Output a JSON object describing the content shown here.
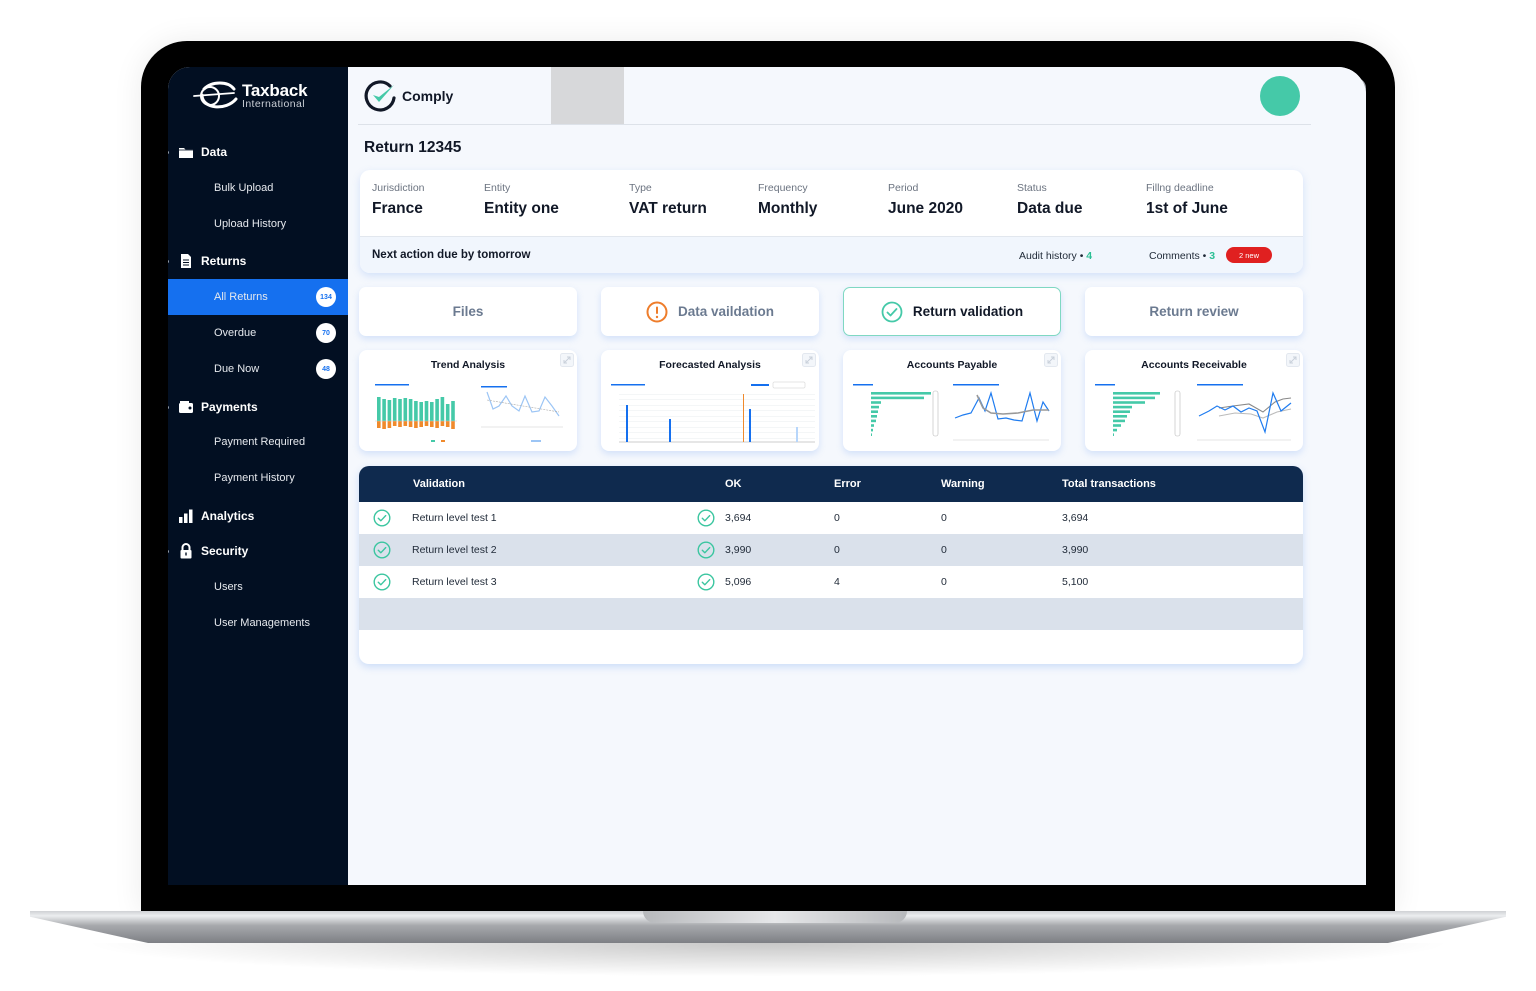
{
  "app": {
    "logo_title": "Taxback",
    "logo_subtitle": "International",
    "brand_name": "Comply"
  },
  "sidebar": {
    "sections": [
      {
        "label": "Data",
        "icon": "folder-icon",
        "items": [
          {
            "label": "Bulk Upload"
          },
          {
            "label": "Upload History"
          }
        ]
      },
      {
        "label": "Returns",
        "icon": "document-icon",
        "items": [
          {
            "label": "All Returns",
            "badge": "134",
            "active": true
          },
          {
            "label": "Overdue",
            "badge": "70"
          },
          {
            "label": "Due Now",
            "badge": "48"
          }
        ]
      },
      {
        "label": "Payments",
        "icon": "wallet-icon",
        "items": [
          {
            "label": "Payment Required"
          },
          {
            "label": "Payment History"
          }
        ]
      },
      {
        "label": "Analytics",
        "icon": "bar-chart-icon",
        "items": []
      },
      {
        "label": "Security",
        "icon": "lock-icon",
        "items": [
          {
            "label": "Users"
          },
          {
            "label": "User Managements"
          }
        ]
      }
    ]
  },
  "page": {
    "title": "Return 12345"
  },
  "info": {
    "fields": [
      {
        "label": "Jurisdiction",
        "value": "France"
      },
      {
        "label": "Entity",
        "value": "Entity one"
      },
      {
        "label": "Type",
        "value": "VAT return"
      },
      {
        "label": "Frequency",
        "value": "Monthly"
      },
      {
        "label": "Period",
        "value": "June 2020"
      },
      {
        "label": "Status",
        "value": "Data due"
      },
      {
        "label": "Fillng deadline",
        "value": "1st of June"
      }
    ],
    "next_action": "Next action due by tomorrow",
    "audit_label": "Audit history •",
    "audit_count": "4",
    "comments_label": "Comments •",
    "comments_count": "3",
    "new_badge": "2 new"
  },
  "steps": [
    {
      "label": "Files",
      "state": "default"
    },
    {
      "label": "Data vaildation",
      "state": "warning",
      "icon": "warning-circle-icon"
    },
    {
      "label": "Return validation",
      "state": "active",
      "icon": "check-circle-icon"
    },
    {
      "label": "Return review",
      "state": "default"
    }
  ],
  "charts": [
    {
      "title": "Trend Analysis"
    },
    {
      "title": "Forecasted Analysis"
    },
    {
      "title": "Accounts Payable"
    },
    {
      "title": "Accounts Receivable"
    }
  ],
  "table": {
    "columns": [
      "Validation",
      "OK",
      "Error",
      "Warning",
      "Total transactions"
    ],
    "rows": [
      {
        "name": "Return level test 1",
        "ok": "3,694",
        "error": "0",
        "warning": "0",
        "total": "3,694"
      },
      {
        "name": "Return level test 2",
        "ok": "3,990",
        "error": "0",
        "warning": "0",
        "total": "3,990"
      },
      {
        "name": "Return level test 3",
        "ok": "5,096",
        "error": "4",
        "warning": "0",
        "total": "5,100"
      }
    ]
  },
  "colors": {
    "sidebar_bg": "#020f22",
    "active_blue": "#1570ef",
    "teal": "#45c9a8",
    "warning_orange": "#ee7d2b",
    "table_header": "#0f2a4e",
    "badge_red": "#e02020"
  }
}
